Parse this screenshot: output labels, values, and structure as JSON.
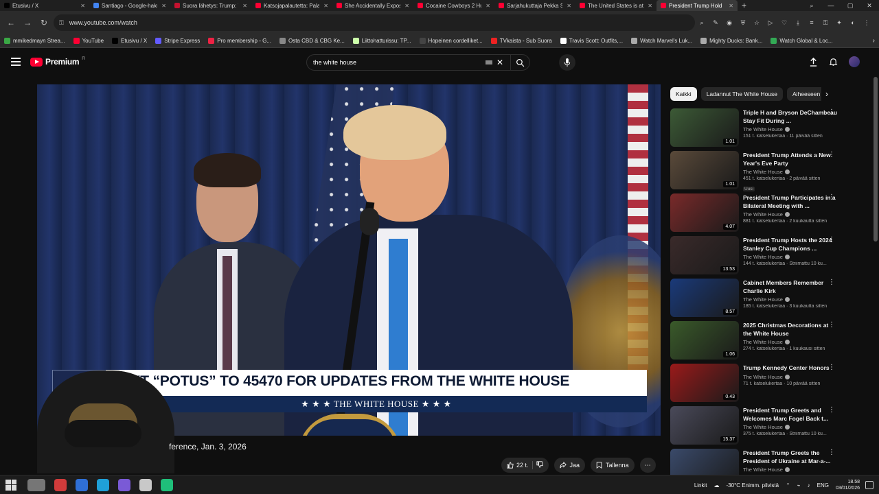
{
  "browser": {
    "tabs": [
      {
        "label": "Etusivu / X",
        "color": "#000000"
      },
      {
        "label": "Santiago - Google-haku",
        "color": "#4285f4"
      },
      {
        "label": "Suora lähetys: Trump: Yh",
        "color": "#c4122f"
      },
      {
        "label": "Katsojapalautetta: Paland",
        "color": "#ff0033"
      },
      {
        "label": "She Accidentally Exposed",
        "color": "#ff0033"
      },
      {
        "label": "Cocaine Cowboys 2 Hust",
        "color": "#ff0033"
      },
      {
        "label": "Sarjahukuttaja Pekka Sepp",
        "color": "#ff0033"
      },
      {
        "label": "The United States is at W",
        "color": "#ff0033"
      },
      {
        "label": "President Trump Hold",
        "color": "#ff0033",
        "active": true
      }
    ],
    "url": "www.youtube.com/watch",
    "bookmarks": [
      {
        "label": "mmikedmayn Strea...",
        "color": "#3aa845"
      },
      {
        "label": "YouTube",
        "color": "#ff0033"
      },
      {
        "label": "Etusivu / X",
        "color": "#000000"
      },
      {
        "label": "Stripe Express",
        "color": "#635bff"
      },
      {
        "label": "Pro membership - G...",
        "color": "#e24"
      },
      {
        "label": "Osta CBD & CBG Ke...",
        "color": "#888"
      },
      {
        "label": "Liittohatturissu: TP...",
        "color": "#cfa"
      },
      {
        "label": "Hopeinen cordelliket...",
        "color": "#444"
      },
      {
        "label": "TVkaista - Sub Suora",
        "color": "#e22"
      },
      {
        "label": "Travis Scott: Outfits,...",
        "color": "#fff"
      },
      {
        "label": "Watch Marvel's Luk...",
        "color": "#aaa"
      },
      {
        "label": "Mighty Ducks: Bank...",
        "color": "#aaa"
      },
      {
        "label": "Watch Global & Loc...",
        "color": "#3a5"
      }
    ]
  },
  "yt": {
    "logo_text": "Premium",
    "logo_sup": "FI",
    "search_value": "the white house",
    "video": {
      "lowerthird_top": "TEXT “POTUS” TO 45470 FOR UPDATES FROM THE WHITE HOUSE",
      "lowerthird_bottom": "★ ★ ★  THE WHITE HOUSE  ★ ★ ★",
      "title": "ference, Jan. 3, 2026"
    },
    "actions": {
      "likes": "22 t.",
      "share": "Jaa",
      "save": "Tallenna"
    },
    "chips": [
      {
        "label": "Kaikki",
        "active": true
      },
      {
        "label": "Ladannut The White House",
        "active": false
      },
      {
        "label": "Aiheeseen",
        "active": false
      }
    ],
    "recs": [
      {
        "title": "Triple H and Bryson DeChambeau Stay Fit During ...",
        "channel": "The White House",
        "stats": "151 t. katselukertaa · 11 päivää sitten",
        "duration": "1.01",
        "thumb": "#3c5a36"
      },
      {
        "title": "President Trump Attends a New Year's Eve Party",
        "channel": "The White House",
        "stats": "451 t. katselukertaa · 2 päivää sitten",
        "duration": "1.01",
        "thumb": "#5a4a3a",
        "badge": "Uusi"
      },
      {
        "title": "President Trump Participates in a Bilateral Meeting with ...",
        "channel": "The White House",
        "stats": "881 t. katselukertaa · 2 kuukautta sitten",
        "duration": "4.07",
        "thumb": "#7a2a2a"
      },
      {
        "title": "President Trump Hosts the 2024 Stanley Cup Champions ...",
        "channel": "The White House",
        "stats": "144 t. katselukertaa · Striimattu 10 ku...",
        "duration": "13.53",
        "thumb": "#3a2a2a"
      },
      {
        "title": "Cabinet Members Remember Charlie Kirk",
        "channel": "The White House",
        "stats": "185 t. katselukertaa · 3 kuukautta sitten",
        "duration": "8.57",
        "thumb": "#1a3a7a"
      },
      {
        "title": "2025 Christmas Decorations at the White House",
        "channel": "The White House",
        "stats": "274 t. katselukertaa · 1 kuukausi sitten",
        "duration": "1.06",
        "thumb": "#3a5a2a"
      },
      {
        "title": "Trump Kennedy Center Honors",
        "channel": "The White House",
        "stats": "71 t. katselukertaa · 10 päivää sitten",
        "duration": "0.43",
        "thumb": "#9a1a1a"
      },
      {
        "title": "President Trump Greets and Welcomes Marc Fogel Back t...",
        "channel": "The White House",
        "stats": "375 t. katselukertaa · Striimattu 10 ku...",
        "duration": "15.37",
        "thumb": "#4a4a5a"
      },
      {
        "title": "President Trump Greets the President of Ukraine at Mar-a-...",
        "channel": "The White House",
        "stats": "",
        "duration": "",
        "thumb": "#3a4a6a"
      }
    ]
  },
  "taskbar": {
    "links": "Linkit",
    "weather": "-30°C  Enimm. pilvistä",
    "lang": "ENG",
    "time": "18.58",
    "date": "03/01/2026",
    "apps": [
      "#cfcfcf",
      "#d13b3b",
      "#2f6fd6",
      "#1fa0d8",
      "#7a5ad6",
      "#c8c8c8",
      "#1fbf7a"
    ]
  }
}
